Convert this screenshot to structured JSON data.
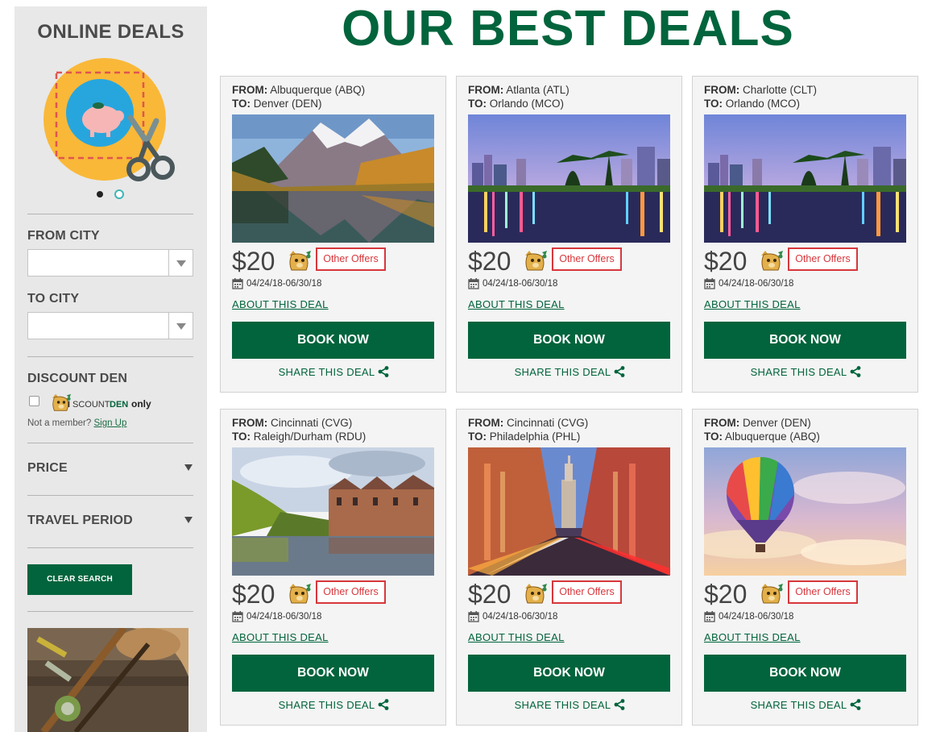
{
  "sidebar": {
    "title": "ONLINE DEALS",
    "from_city_label": "FROM CITY",
    "from_city_value": "",
    "to_city_label": "TO CITY",
    "to_city_value": "",
    "discount_den_label": "DISCOUNT DEN",
    "discount_den_logo_text": "DISCOUNTDEN only",
    "member_prompt": "Not a member?",
    "sign_up": "Sign Up",
    "price_label": "PRICE",
    "travel_period_label": "TRAVEL PERIOD",
    "clear_search": "CLEAR SEARCH"
  },
  "page_title": "OUR BEST DEALS",
  "labels": {
    "from": "FROM:",
    "to": "TO:",
    "other_offers": "Other Offers",
    "about": "ABOUT THIS DEAL",
    "book": "BOOK NOW",
    "share": "SHARE THIS DEAL"
  },
  "deals": [
    {
      "from": "Albuquerque (ABQ)",
      "to": "Denver (DEN)",
      "price": "$20",
      "dates": "04/24/18-06/30/18",
      "image": "mountain-lake-photo"
    },
    {
      "from": "Atlanta (ATL)",
      "to": "Orlando (MCO)",
      "price": "$20",
      "dates": "04/24/18-06/30/18",
      "image": "orlando-skyline-photo"
    },
    {
      "from": "Charlotte (CLT)",
      "to": "Orlando (MCO)",
      "price": "$20",
      "dates": "04/24/18-06/30/18",
      "image": "orlando-skyline-photo"
    },
    {
      "from": "Cincinnati (CVG)",
      "to": "Raleigh/Durham (RDU)",
      "price": "$20",
      "dates": "04/24/18-06/30/18",
      "image": "river-buildings-photo"
    },
    {
      "from": "Cincinnati (CVG)",
      "to": "Philadelphia (PHL)",
      "price": "$20",
      "dates": "04/24/18-06/30/18",
      "image": "philadelphia-street-photo"
    },
    {
      "from": "Denver (DEN)",
      "to": "Albuquerque (ABQ)",
      "price": "$20",
      "dates": "04/24/18-06/30/18",
      "image": "hot-air-balloon-photo"
    }
  ],
  "colors": {
    "brand_green": "#02643c",
    "offer_red": "#d7373c",
    "sidebar_bg": "#e8e8e8",
    "card_bg": "#f4f4f4"
  }
}
